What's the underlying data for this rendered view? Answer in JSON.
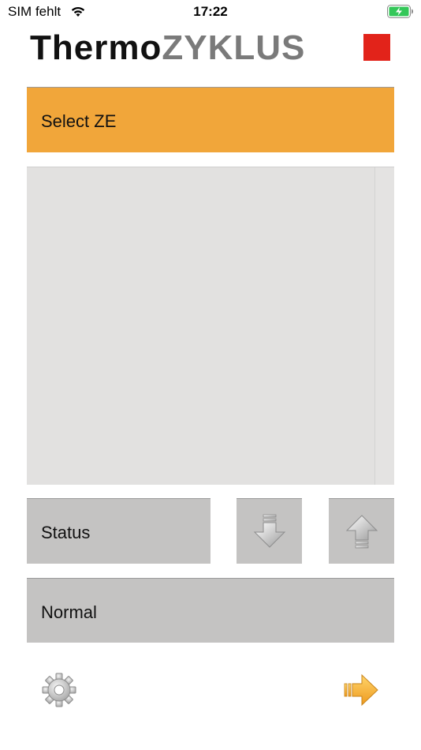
{
  "statusbar": {
    "carrier": "SIM fehlt",
    "time": "17:22"
  },
  "logo": {
    "part1": "Thermo",
    "part2": "ZYKLUS"
  },
  "select": {
    "label": "Select ZE"
  },
  "status": {
    "label": "Status"
  },
  "mode": {
    "label": "Normal"
  },
  "icons": {
    "wifi": "wifi-icon",
    "battery": "battery-charging-icon",
    "down": "arrow-down-icon",
    "up": "arrow-up-icon",
    "settings": "gear-icon",
    "next": "arrow-right-icon"
  },
  "colors": {
    "header_orange": "#f1a63a",
    "panel_gray": "#c4c3c2",
    "list_gray": "#e2e1e0",
    "logo_red": "#e2231a",
    "battery_green": "#34c759"
  }
}
